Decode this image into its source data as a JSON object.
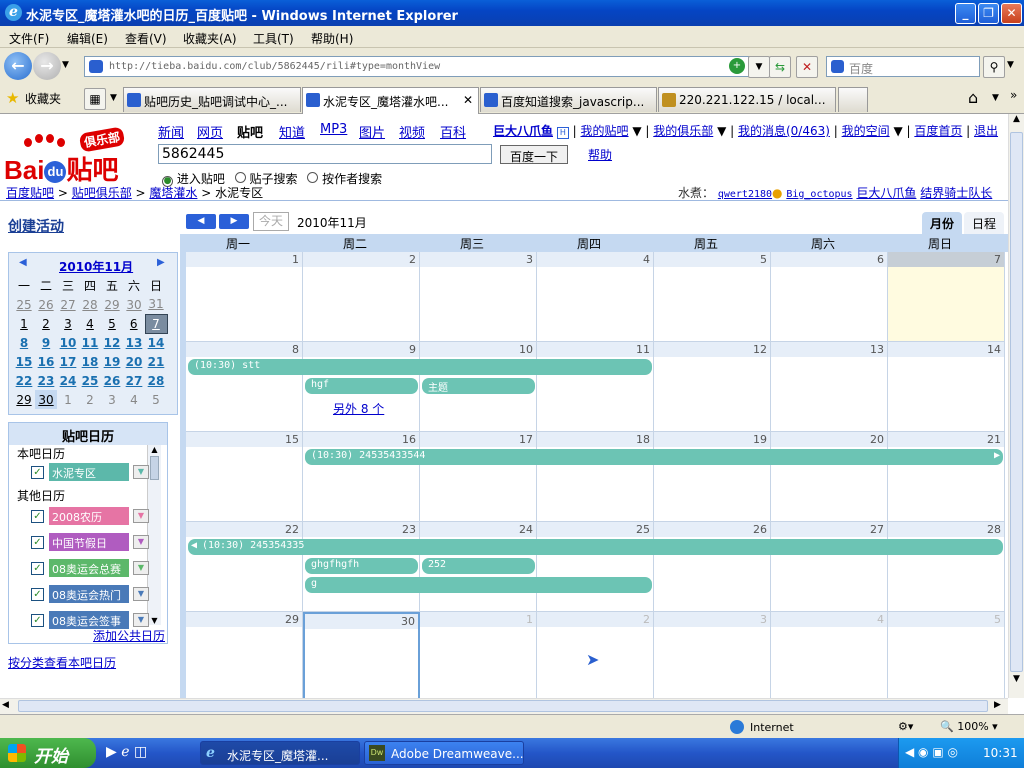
{
  "window": {
    "title": "水泥专区_魔塔灌水吧的日历_百度贴吧 - Windows Internet Explorer"
  },
  "menu": [
    "文件(F)",
    "编辑(E)",
    "查看(V)",
    "收藏夹(A)",
    "工具(T)",
    "帮助(H)"
  ],
  "address": {
    "url": "http://tieba.baidu.com/club/5862445/rili#type=monthView"
  },
  "search_box": {
    "placeholder": "百度"
  },
  "favorites_label": "收藏夹",
  "tabs": [
    {
      "label": "贴吧历史_贴吧调试中心_...",
      "active": false
    },
    {
      "label": "水泥专区_魔塔灌水吧...",
      "active": true
    },
    {
      "label": "百度知道搜索_javascrip...",
      "active": false
    },
    {
      "label": "220.221.122.15 / local...",
      "active": false
    }
  ],
  "page": {
    "logo_text": "Bai du 贴吧",
    "logo_badge": "俱乐部",
    "nav_links": [
      "新闻",
      "网页",
      "贴吧",
      "知道",
      "MP3",
      "图片",
      "视频",
      "百科"
    ],
    "nav_active": "贴吧",
    "search_value": "5862445",
    "search_button": "百度一下",
    "help_link": "帮助",
    "radio_options": [
      "进入贴吧",
      "贴子搜索",
      "按作者搜索"
    ],
    "radio_selected": 0,
    "user_links": [
      "巨大八爪鱼",
      "我的贴吧",
      "我的俱乐部",
      "我的消息(0/463)",
      "我的空间",
      "百度首页",
      "退出"
    ],
    "breadcrumb": [
      "百度贴吧",
      "贴吧俱乐部",
      "魔塔灌水",
      "水泥专区"
    ],
    "members_label": "水煮：",
    "members": [
      "qwert2180",
      "Big_octopus",
      "巨大八爪鱼",
      "结界骑士队长"
    ],
    "create_activity": "创建活动",
    "mini_cal": {
      "title": "2010年11月",
      "weekdays": [
        "一",
        "二",
        "三",
        "四",
        "五",
        "六",
        "日"
      ],
      "rows": [
        [
          "25",
          "26",
          "27",
          "28",
          "29",
          "30",
          "31"
        ],
        [
          "1",
          "2",
          "3",
          "4",
          "5",
          "6",
          "7"
        ],
        [
          "8",
          "9",
          "10",
          "11",
          "12",
          "13",
          "14"
        ],
        [
          "15",
          "16",
          "17",
          "18",
          "19",
          "20",
          "21"
        ],
        [
          "22",
          "23",
          "24",
          "25",
          "26",
          "27",
          "28"
        ],
        [
          "29",
          "30",
          "1",
          "2",
          "3",
          "4",
          "5"
        ]
      ]
    },
    "calendar_panel": {
      "title": "贴吧日历",
      "this_bar_label": "本吧日历",
      "other_label": "其他日历",
      "this_bar": [
        {
          "name": "水泥专区",
          "color": "#5cb8aa"
        }
      ],
      "others": [
        {
          "name": "2008农历",
          "color": "#e674a4"
        },
        {
          "name": "中国节假日",
          "color": "#b05cc0"
        },
        {
          "name": "08奥运会总赛",
          "color": "#5cb86a"
        },
        {
          "name": "08奥运会热门",
          "color": "#4a7ab8"
        },
        {
          "name": "08奥运会签事",
          "color": "#4a7ab8"
        }
      ],
      "add_public": "添加公共日历"
    },
    "category_link": "按分类查看本吧日历",
    "toolbar": {
      "today": "今天",
      "month_label": "2010年11月",
      "view_month": "月份",
      "view_schedule": "日程"
    },
    "weekday_headers": [
      "周一",
      "周二",
      "周三",
      "周四",
      "周五",
      "周六",
      "周日"
    ],
    "weeks": [
      [
        "1",
        "2",
        "3",
        "4",
        "5",
        "6",
        "7"
      ],
      [
        "8",
        "9",
        "10",
        "11",
        "12",
        "13",
        "14"
      ],
      [
        "15",
        "16",
        "17",
        "18",
        "19",
        "20",
        "21"
      ],
      [
        "22",
        "23",
        "24",
        "25",
        "26",
        "27",
        "28"
      ],
      [
        "29",
        "30",
        "1",
        "2",
        "3",
        "4",
        "5"
      ]
    ],
    "events": {
      "w2a": "(10:30) stt",
      "w2b": "hgf",
      "w2c": "主题",
      "w2more": "另外 8 个",
      "w3a": "(10:30) 24535433544",
      "w4a": "(10:30) 245354335",
      "w4b": "ghgfhgfh",
      "w4c": "252",
      "w4d": "g"
    }
  },
  "status": {
    "zone": "Internet",
    "zoom": "100%"
  },
  "taskbar": {
    "start": "开始",
    "buttons": [
      "水泥专区_魔塔灌...",
      "Adobe Dreamweave..."
    ],
    "clock": "10:31"
  },
  "colors": {
    "event": "#6cc4b4",
    "today_bg": "#fffbe0",
    "weekday_header": "#c5d9f1"
  }
}
